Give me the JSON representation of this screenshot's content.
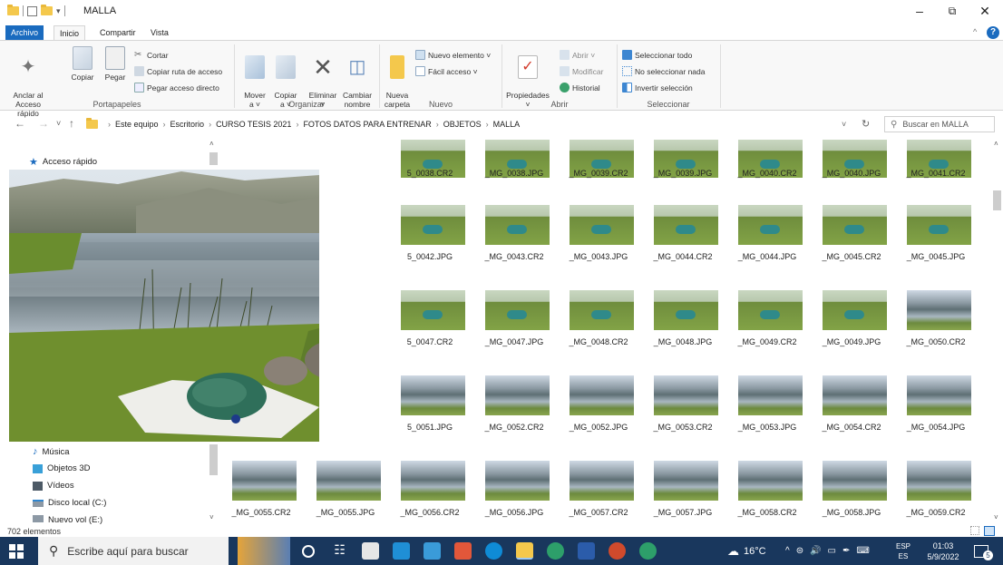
{
  "window": {
    "title": "MALLA",
    "minimize": "–",
    "maximize": "⧉",
    "close": "✕",
    "help": "?",
    "collapse": "^"
  },
  "tabs": [
    "Archivo",
    "Inicio",
    "Compartir",
    "Vista"
  ],
  "ribbon": {
    "portapapeles": {
      "anclar": "Anclar al\nAcceso rápido",
      "copiar": "Copiar",
      "pegar": "Pegar",
      "cortar": "Cortar",
      "copiar_ruta": "Copiar ruta de acceso",
      "pegar_directo": "Pegar acceso directo",
      "label": "Portapapeles"
    },
    "organizar": {
      "mover": "Mover\na ˅",
      "copiar": "Copiar\na ˅",
      "eliminar": "Eliminar\n˅",
      "cambiar": "Cambiar\nnombre",
      "label": "Organizar"
    },
    "nuevo": {
      "nueva_carpeta": "Nueva\ncarpeta",
      "nuevo_elemento": "Nuevo elemento ˅",
      "facil_acceso": "Fácil acceso ˅",
      "label": "Nuevo"
    },
    "abrir": {
      "propiedades": "Propiedades\n˅",
      "abrir": "Abrir ˅",
      "modificar": "Modificar",
      "historial": "Historial",
      "label": "Abrir"
    },
    "seleccionar": {
      "todo": "Seleccionar todo",
      "nada": "No seleccionar nada",
      "invertir": "Invertir selección",
      "label": "Seleccionar"
    }
  },
  "address": {
    "back": "←",
    "forward": "→",
    "recent": "˅",
    "up": "↑",
    "breadcrumb": [
      "Este equipo",
      "Escritorio",
      "CURSO TESIS 2021",
      "FOTOS DATOS PARA ENTRENAR",
      "OBJETOS",
      "MALLA"
    ],
    "dropdown": "˅",
    "refresh": "↻",
    "search_placeholder": "Buscar en MALLA"
  },
  "sidebar": {
    "quick_access": "Acceso rápido",
    "items": [
      "Música",
      "Objetos 3D",
      "Vídeos",
      "Disco local (C:)",
      "Nuevo vol (E:)"
    ]
  },
  "files": [
    {
      "name": "_MG_0038.CR2",
      "thumb": "green"
    },
    {
      "name": "_MG_0038.CR2",
      "thumb": "green"
    },
    {
      "name": "_MG_0038.CR2",
      "thumb": "green"
    },
    {
      "name": "_MG_0038.JPG",
      "thumb": "green"
    },
    {
      "name": "_MG_0039.CR2",
      "thumb": "green"
    },
    {
      "name": "_MG_0039.JPG",
      "thumb": "green"
    },
    {
      "name": "_MG_0040.CR2",
      "thumb": "green"
    },
    {
      "name": "_MG_0040.JPG",
      "thumb": "green"
    },
    {
      "name": "_MG_0041.CR2",
      "thumb": "green"
    },
    {
      "name": "_MG_0042.JPG",
      "thumb": "green"
    },
    {
      "name": "_MG_0042.JPG",
      "thumb": "green"
    },
    {
      "name": "_MG_0042.JPG",
      "thumb": "green"
    },
    {
      "name": "_MG_0043.CR2",
      "thumb": "green"
    },
    {
      "name": "_MG_0043.JPG",
      "thumb": "green"
    },
    {
      "name": "_MG_0044.CR2",
      "thumb": "green"
    },
    {
      "name": "_MG_0044.JPG",
      "thumb": "green"
    },
    {
      "name": "_MG_0045.CR2",
      "thumb": "green"
    },
    {
      "name": "_MG_0045.JPG",
      "thumb": "green"
    },
    {
      "name": "_MG_0047.CR2",
      "thumb": "green"
    },
    {
      "name": "_MG_0047.CR2",
      "thumb": "green"
    },
    {
      "name": "_MG_0047.CR2",
      "thumb": "green"
    },
    {
      "name": "_MG_0047.JPG",
      "thumb": "green"
    },
    {
      "name": "_MG_0048.CR2",
      "thumb": "green"
    },
    {
      "name": "_MG_0048.JPG",
      "thumb": "green"
    },
    {
      "name": "_MG_0049.CR2",
      "thumb": "green"
    },
    {
      "name": "_MG_0049.JPG",
      "thumb": "green"
    },
    {
      "name": "_MG_0050.CR2",
      "thumb": "lake"
    },
    {
      "name": "_MG_0051.JPG",
      "thumb": "lake"
    },
    {
      "name": "_MG_0051.JPG",
      "thumb": "lake"
    },
    {
      "name": "_MG_0051.JPG",
      "thumb": "lake"
    },
    {
      "name": "_MG_0052.CR2",
      "thumb": "lake"
    },
    {
      "name": "_MG_0052.JPG",
      "thumb": "lake"
    },
    {
      "name": "_MG_0053.CR2",
      "thumb": "lake"
    },
    {
      "name": "_MG_0053.JPG",
      "thumb": "lake"
    },
    {
      "name": "_MG_0054.CR2",
      "thumb": "lake"
    },
    {
      "name": "_MG_0054.JPG",
      "thumb": "lake"
    },
    {
      "name": "_MG_0055.CR2",
      "thumb": "lake"
    },
    {
      "name": "_MG_0055.CR2",
      "thumb": "lake"
    },
    {
      "name": "_MG_0055.CR2",
      "thumb": "lake"
    },
    {
      "name": "_MG_0055.JPG",
      "thumb": "lake"
    },
    {
      "name": "_MG_0056.CR2",
      "thumb": "lake"
    },
    {
      "name": "_MG_0056.JPG",
      "thumb": "lake"
    },
    {
      "name": "_MG_0057.CR2",
      "thumb": "lake"
    },
    {
      "name": "_MG_0057.JPG",
      "thumb": "lake"
    },
    {
      "name": "_MG_0058.CR2",
      "thumb": "lake"
    }
  ],
  "visible_file_names": [
    "5_0038.CR2",
    "_MG_0038.JPG",
    "_MG_0039.CR2",
    "_MG_0039.JPG",
    "_MG_0040.CR2",
    "_MG_0040.JPG",
    "_MG_0041.CR2",
    "5_0042.JPG",
    "_MG_0043.CR2",
    "_MG_0043.JPG",
    "_MG_0044.CR2",
    "_MG_0044.JPG",
    "_MG_0045.CR2",
    "_MG_0045.JPG",
    "5_0047.CR2",
    "_MG_0047.JPG",
    "_MG_0048.CR2",
    "_MG_0048.JPG",
    "_MG_0049.CR2",
    "_MG_0049.JPG",
    "_MG_0050.CR2",
    "5_0051.JPG",
    "_MG_0052.CR2",
    "_MG_0052.JPG",
    "_MG_0053.CR2",
    "_MG_0053.JPG",
    "_MG_0054.CR2",
    "_MG_0054.JPG",
    "_MG_0055.CR2",
    "_MG_0055.JPG",
    "_MG_0056.CR2",
    "_MG_0056.JPG",
    "_MG_0057.CR2",
    "_MG_0057.JPG",
    "_MG_0058.CR2",
    "_MG_0058.JPG",
    "_MG_0059.CR2"
  ],
  "status": {
    "count": "702 elementos"
  },
  "taskbar": {
    "search_placeholder": "Escribe aquí para buscar",
    "weather": "16°C",
    "lang_top": "ESP",
    "lang_bottom": "ES",
    "time": "01:03",
    "date": "5/9/2022",
    "notifications": "5"
  },
  "colors": {
    "accent": "#1a6bbf",
    "taskbar": "#19375d",
    "folder": "#f4c84c"
  }
}
